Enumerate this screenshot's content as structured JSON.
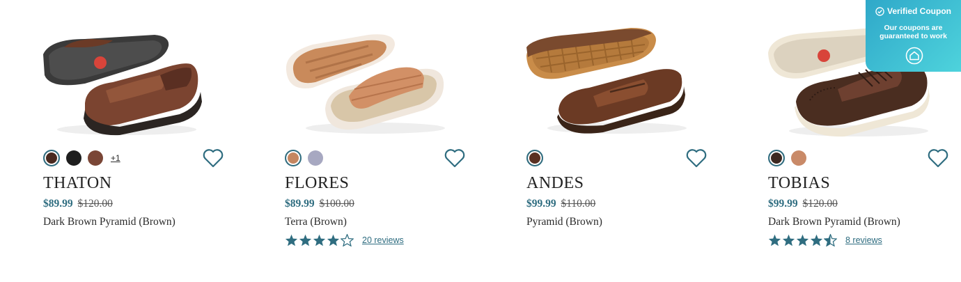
{
  "colors": {
    "accent": "#2f6d80",
    "star": "#2f6d80",
    "coupon": "#35b4d0"
  },
  "coupon": {
    "title": "Verified Coupon",
    "subtitle": "Our coupons are guaranteed to work",
    "icons": [
      "check-circle-icon",
      "home-icon"
    ]
  },
  "products": [
    {
      "name": "THATON",
      "sale_price": "$89.99",
      "original_price": "$120.00",
      "color": "Dark Brown Pyramid (Brown)",
      "swatches": [
        "#4a2a20",
        "#1e1e1e",
        "#7a4636"
      ],
      "more_colors": "+1",
      "rating": null,
      "reviews": ""
    },
    {
      "name": "FLORES",
      "sale_price": "$89.99",
      "original_price": "$100.00",
      "color": "Terra (Brown)",
      "swatches": [
        "#c58660",
        "#a7a8c1"
      ],
      "more_colors": "",
      "rating": 4,
      "reviews": "20 reviews"
    },
    {
      "name": "ANDES",
      "sale_price": "$99.99",
      "original_price": "$110.00",
      "color": "Pyramid (Brown)",
      "swatches": [
        "#5a3022"
      ],
      "more_colors": "",
      "rating": null,
      "reviews": ""
    },
    {
      "name": "TOBIAS",
      "sale_price": "$99.99",
      "original_price": "$120.00",
      "color": "Dark Brown Pyramid (Brown)",
      "swatches": [
        "#3d2820",
        "#c98a68"
      ],
      "more_colors": "",
      "rating": 4.5,
      "reviews": "8 reviews"
    }
  ]
}
